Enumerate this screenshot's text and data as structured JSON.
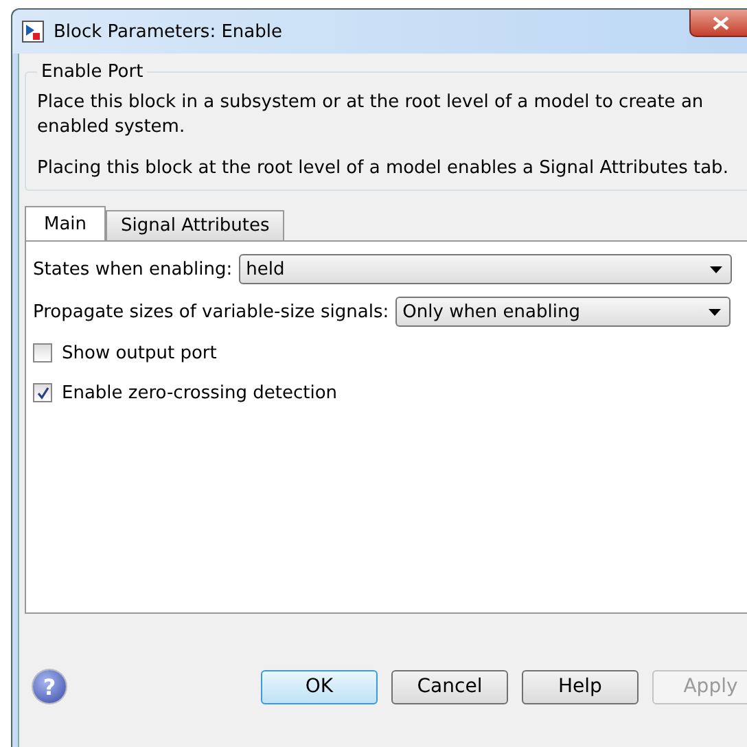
{
  "window": {
    "title": "Block Parameters: Enable"
  },
  "group": {
    "title": "Enable Port",
    "paragraphs": [
      "Place this block in a subsystem or at the root level of a model to create an enabled system.",
      "Placing this block at the root level of a model enables a Signal Attributes tab."
    ]
  },
  "tabs": [
    {
      "label": "Main",
      "selected": true
    },
    {
      "label": "Signal Attributes",
      "selected": false
    }
  ],
  "fields": [
    {
      "kind": "dropdown",
      "label": "States when enabling:",
      "value": "held"
    },
    {
      "kind": "dropdown",
      "label": "Propagate sizes of variable-size signals:",
      "value": "Only when enabling"
    },
    {
      "kind": "checkbox",
      "label": "Show output port",
      "checked": false
    },
    {
      "kind": "checkbox",
      "label": "Enable zero-crossing detection",
      "checked": true
    }
  ],
  "help_icon": "?",
  "buttons": [
    {
      "label": "OK",
      "default": true,
      "disabled": false
    },
    {
      "label": "Cancel",
      "default": false,
      "disabled": false
    },
    {
      "label": "Help",
      "default": false,
      "disabled": false
    },
    {
      "label": "Apply",
      "default": false,
      "disabled": true
    }
  ]
}
